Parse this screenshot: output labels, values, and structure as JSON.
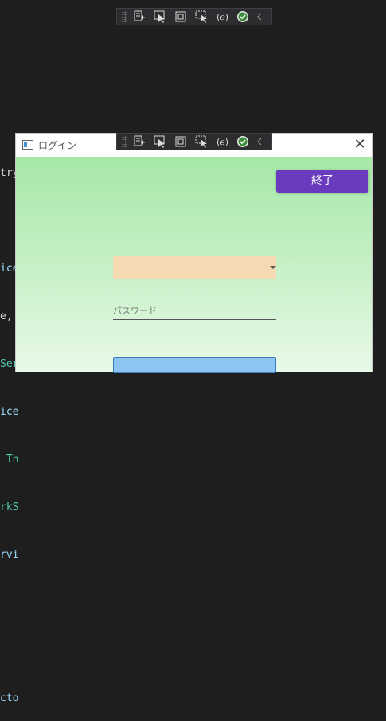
{
  "debug_toolbar": {
    "icons": [
      "live-tree-icon",
      "select-element-icon",
      "display-layout-adorners-icon",
      "track-focus-icon",
      "binding-failures-icon",
      "hot-reload-ok-icon",
      "collapse-chevron-icon"
    ]
  },
  "code_behind": {
    "lines": [
      "try",
      "",
      "ice",
      "e,",
      "Ser",
      "ice",
      " Th",
      "rkS",
      "rvi",
      "",
      "",
      "cto"
    ]
  },
  "window": {
    "title": "ログイン",
    "exit_label": "終了",
    "role_combo_value": "",
    "password_placeholder": "パスワード"
  },
  "colors": {
    "exit_button": "#6a3bbf",
    "combo_background": "#f5d9b2",
    "gradient_top": "#a6e8a8",
    "gradient_bottom": "#e8f9e8"
  }
}
